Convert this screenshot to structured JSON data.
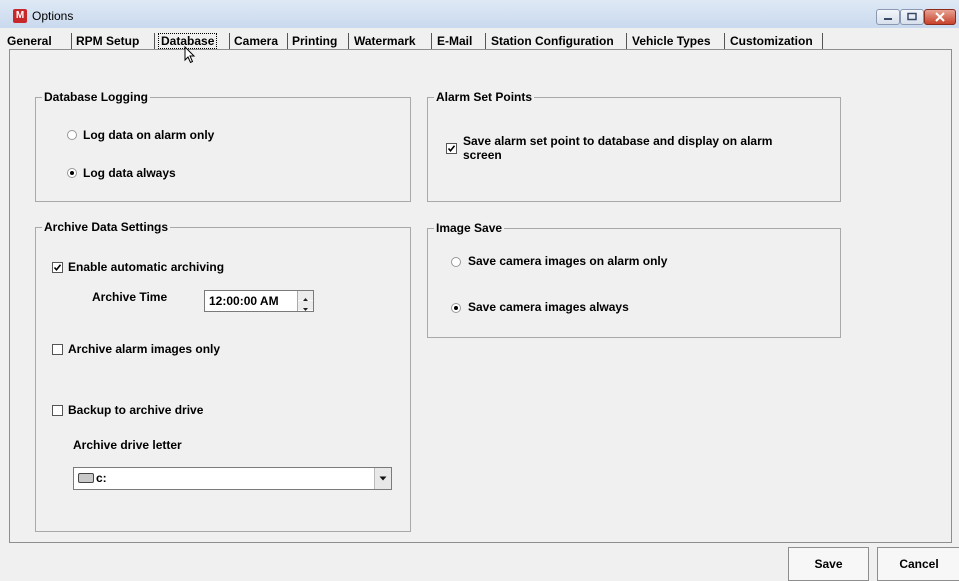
{
  "window": {
    "title": "Options",
    "app_icon_letter": "M"
  },
  "tabs": [
    {
      "label": "General"
    },
    {
      "label": "RPM Setup"
    },
    {
      "label": "Database",
      "selected": true
    },
    {
      "label": "Camera"
    },
    {
      "label": "Printing"
    },
    {
      "label": "Watermark"
    },
    {
      "label": "E-Mail"
    },
    {
      "label": "Station Configuration"
    },
    {
      "label": "Vehicle Types"
    },
    {
      "label": "Customization"
    }
  ],
  "database_logging": {
    "title": "Database Logging",
    "option_alarm_only": "Log data on alarm only",
    "option_always": "Log data always",
    "selected": "always"
  },
  "alarm_set_points": {
    "title": "Alarm Set Points",
    "save_label_line1": "Save alarm set point to database and display on alarm",
    "save_label_line2": "screen",
    "save_checked": true
  },
  "archive": {
    "title": "Archive Data Settings",
    "enable_label": "Enable automatic archiving",
    "enable_checked": true,
    "archive_time_label": "Archive Time",
    "archive_time_value": "12:00:00 AM",
    "alarm_images_label": "Archive alarm images only",
    "alarm_images_checked": false,
    "backup_label": "Backup to archive drive",
    "backup_checked": false,
    "drive_letter_label": "Archive drive letter",
    "drive_value": "c:"
  },
  "image_save": {
    "title": "Image Save",
    "option_alarm_only": "Save camera images on alarm only",
    "option_always": "Save camera images always",
    "selected": "always"
  },
  "buttons": {
    "save": "Save",
    "cancel": "Cancel"
  },
  "icons": [
    "app-icon",
    "minimize-icon",
    "maximize-icon",
    "close-icon",
    "checkmark-icon",
    "drive-icon",
    "spin-up-icon",
    "spin-down-icon",
    "dropdown-arrow-icon",
    "mouse-cursor-icon"
  ]
}
